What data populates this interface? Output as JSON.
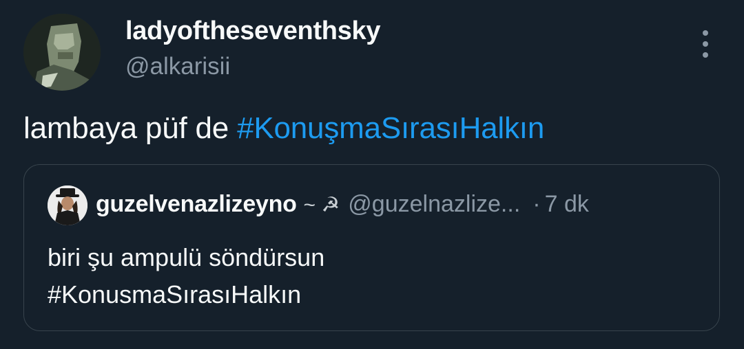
{
  "tweet": {
    "display_name": "ladyoftheseventhsky",
    "handle": "@alkarisii",
    "text": "lambaya püf de ",
    "hashtag": "#KonuşmaSırasıHalkın"
  },
  "quoted_tweet": {
    "display_name": "guzelvenazlizeyno",
    "name_suffix": "~ ☭",
    "handle": "@guzelnazlize...",
    "separator": "·",
    "time": "7 dk",
    "text_line1": "biri şu ampulü söndürsun",
    "text_line2": "#KonusmaSırasıHalkın"
  },
  "icons": {
    "more": "more-vertical-icon"
  },
  "colors": {
    "background": "#15202b",
    "text": "#f7f9f9",
    "secondary": "#8b98a5",
    "link": "#1d9bf0",
    "border": "#38444d"
  }
}
